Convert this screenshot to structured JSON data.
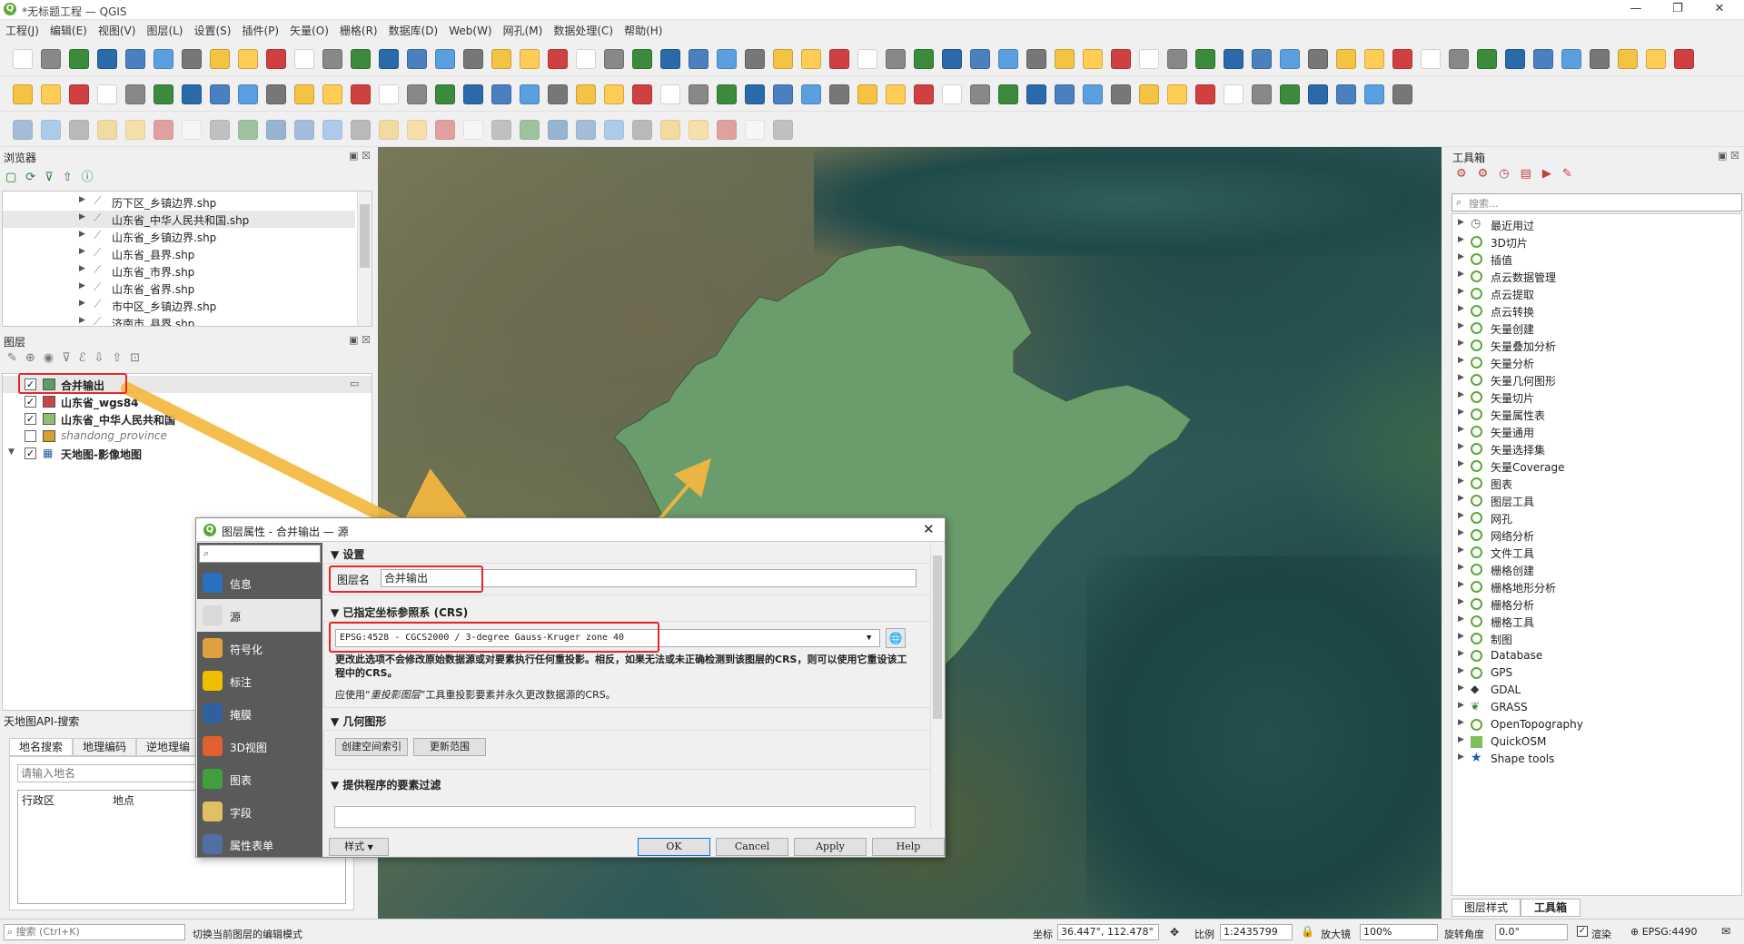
{
  "window": {
    "title": "*无标题工程 — QGIS",
    "minimize": "—",
    "maximize": "❐",
    "close": "✕"
  },
  "menu": [
    "工程(J)",
    "编辑(E)",
    "视图(V)",
    "图层(L)",
    "设置(S)",
    "插件(P)",
    "矢量(O)",
    "栅格(R)",
    "数据库(D)",
    "Web(W)",
    "网孔(M)",
    "数据处理(C)",
    "帮助(H)"
  ],
  "browser": {
    "title": "浏览器",
    "items": [
      "历下区_乡镇边界.shp",
      "山东省_中华人民共和国.shp",
      "山东省_乡镇边界.shp",
      "山东省_县界.shp",
      "山东省_市界.shp",
      "山东省_省界.shp",
      "市中区_乡镇边界.shp",
      "济南市_县界.shp"
    ]
  },
  "layers": {
    "title": "图层",
    "items": [
      {
        "name": "合并输出",
        "checked": true,
        "color": "#5e9c68",
        "bold": true
      },
      {
        "name": "山东省_wgs84",
        "checked": true,
        "color": "#c8464a",
        "bold": true
      },
      {
        "name": "山东省_中华人民共和国",
        "checked": true,
        "color": "#8cc070",
        "bold": true
      },
      {
        "name": "shandong_province",
        "checked": false,
        "color": "#d4a030",
        "bold": false
      },
      {
        "name": "天地图-影像地图",
        "checked": true,
        "color": "",
        "bold": true
      }
    ]
  },
  "tianditu": {
    "title": "天地图API-搜索",
    "tabs": [
      "地名搜索",
      "地理编码",
      "逆地理编"
    ],
    "placeholder": "请输入地名",
    "cols": [
      "行政区",
      "地点"
    ]
  },
  "toolbox": {
    "title": "工具箱",
    "search_placeholder": "搜索...",
    "items": [
      "最近用过",
      "3D切片",
      "插值",
      "点云数据管理",
      "点云提取",
      "点云转换",
      "矢量创建",
      "矢量叠加分析",
      "矢量分析",
      "矢量几何图形",
      "矢量切片",
      "矢量属性表",
      "矢量通用",
      "矢量选择集",
      "矢量Coverage",
      "图表",
      "图层工具",
      "网孔",
      "网络分析",
      "文件工具",
      "栅格创建",
      "栅格地形分析",
      "栅格分析",
      "栅格工具",
      "制图",
      "Database",
      "GPS",
      "GDAL",
      "GRASS",
      "OpenTopography",
      "QuickOSM",
      "Shape tools"
    ],
    "bottom_tabs": [
      "图层样式",
      "工具箱"
    ]
  },
  "dialog": {
    "title": "图层属性 - 合并输出 — 源",
    "sidebar": [
      {
        "label": "信息",
        "color": "#2a70c0"
      },
      {
        "label": "源",
        "color": "#d9d9d9"
      },
      {
        "label": "符号化",
        "color": "#e0a040"
      },
      {
        "label": "标注",
        "color": "#f0c000"
      },
      {
        "label": "掩膜",
        "color": "#3060a0"
      },
      {
        "label": "3D视图",
        "color": "#e06030"
      },
      {
        "label": "图表",
        "color": "#40a040"
      },
      {
        "label": "字段",
        "color": "#e0c060"
      },
      {
        "label": "属性表单",
        "color": "#5070a0"
      }
    ],
    "settings_header": "设置",
    "layer_name_label": "图层名",
    "layer_name_value": "合并输出",
    "crs_header": "已指定坐标参照系 (CRS)",
    "crs_value": "EPSG:4528 - CGCS2000 / 3-degree Gauss-Kruger zone 40",
    "crs_note": "更改此选项不会修改原始数据源或对要素执行任何重投影。相反，如果无法或未正确检测到该图层的CRS，则可以使用它重设该工程中的CRS。",
    "reproject_note_prefix": "应使用“",
    "reproject_note_link": "重投影图层",
    "reproject_note_suffix": "”工具重投影要素并永久更改数据源的CRS。",
    "geometry_header": "几何图形",
    "create_index_btn": "创建空间索引",
    "update_extent_btn": "更新范围",
    "filter_header": "提供程序的要素过滤",
    "style_btn": "样式",
    "ok": "OK",
    "cancel": "Cancel",
    "apply": "Apply",
    "help": "Help"
  },
  "status": {
    "search_placeholder": "搜索 (Ctrl+K)",
    "message": "切换当前图层的编辑模式",
    "coord_label": "坐标",
    "coord_value": "36.447°, 112.478°",
    "scale_label": "比例",
    "scale_value": "1:2435799",
    "magnifier_label": "放大镜",
    "magnifier_value": "100%",
    "rotation_label": "旋转角度",
    "rotation_value": "0.0°",
    "render_label": "渲染",
    "crs": "EPSG:4490"
  },
  "colors": {
    "accent_red": "#e8262a",
    "arrow_orange": "#f5b840",
    "polygon_green": "#6a9c6c"
  }
}
